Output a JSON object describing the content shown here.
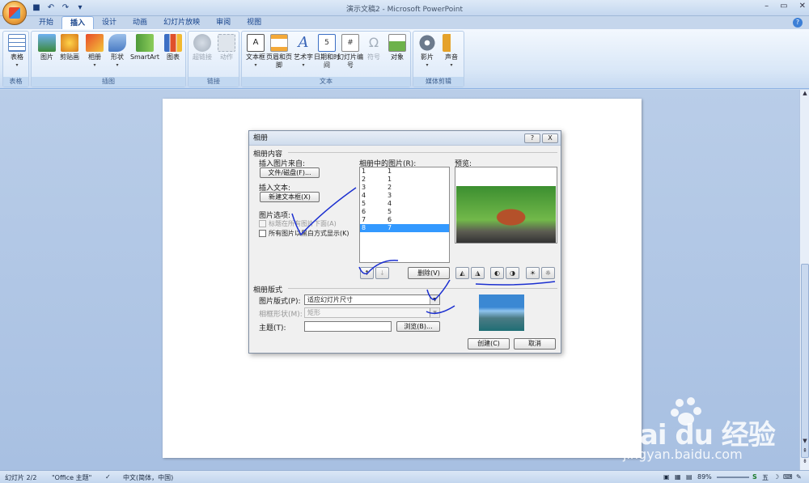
{
  "window": {
    "title": "演示文稿2 - Microsoft PowerPoint"
  },
  "ribbon_tabs": [
    "开始",
    "插入",
    "设计",
    "动画",
    "幻灯片放映",
    "审阅",
    "视图"
  ],
  "active_tab": "插入",
  "ribbon_groups": [
    {
      "label": "表格",
      "buttons": [
        {
          "label": "表格",
          "icon": "table-icon"
        }
      ]
    },
    {
      "label": "插图",
      "buttons": [
        {
          "label": "图片",
          "icon": "picture-icon"
        },
        {
          "label": "剪贴画",
          "icon": "clipart-icon"
        },
        {
          "label": "相册",
          "icon": "photo-album-icon"
        },
        {
          "label": "形状",
          "icon": "shapes-icon"
        },
        {
          "label": "SmartArt",
          "icon": "smartart-icon"
        },
        {
          "label": "图表",
          "icon": "chart-icon"
        }
      ]
    },
    {
      "label": "链接",
      "buttons": [
        {
          "label": "超链接",
          "icon": "hyperlink-icon"
        },
        {
          "label": "动作",
          "icon": "action-icon"
        }
      ]
    },
    {
      "label": "文本",
      "buttons": [
        {
          "label": "文本框",
          "icon": "textbox-icon"
        },
        {
          "label": "页眉和页脚",
          "icon": "header-footer-icon"
        },
        {
          "label": "艺术字",
          "icon": "wordart-icon"
        },
        {
          "label": "日期和时间",
          "icon": "date-time-icon"
        },
        {
          "label": "幻灯片编号",
          "icon": "slide-number-icon"
        },
        {
          "label": "符号",
          "icon": "symbol-icon"
        },
        {
          "label": "对象",
          "icon": "object-icon"
        }
      ]
    },
    {
      "label": "媒体剪辑",
      "buttons": [
        {
          "label": "影片",
          "icon": "movie-icon"
        },
        {
          "label": "声音",
          "icon": "sound-icon"
        }
      ]
    }
  ],
  "dialog": {
    "title": "相册",
    "album_content_label": "相册内容",
    "insert_from_label": "插入图片来自:",
    "file_disk_button": "文件/磁盘(F)...",
    "insert_text_label": "插入文本:",
    "new_textbox_button": "新建文本框(X)",
    "picture_options_label": "图片选项:",
    "caption_option": "标题在所有图片下面(A)",
    "bw_option": "所有图片以黑白方式显示(K)",
    "pictures_in_album_label": "相册中的图片(R):",
    "pictures": [
      {
        "num": "1",
        "name": "1"
      },
      {
        "num": "2",
        "name": "1"
      },
      {
        "num": "3",
        "name": "2"
      },
      {
        "num": "4",
        "name": "3"
      },
      {
        "num": "5",
        "name": "4"
      },
      {
        "num": "6",
        "name": "5"
      },
      {
        "num": "7",
        "name": "6"
      },
      {
        "num": "8",
        "name": "7"
      }
    ],
    "selected_index": 7,
    "preview_label": "预览:",
    "delete_button": "删除(V)",
    "album_layout_label": "相册版式",
    "picture_layout_label": "图片版式(P):",
    "picture_layout_value": "适应幻灯片尺寸",
    "frame_shape_label": "相框形状(M):",
    "frame_shape_value": "矩形",
    "theme_label": "主题(T):",
    "theme_value": "",
    "browse_button": "浏览(B)...",
    "create_button": "创建(C)",
    "cancel_button": "取消",
    "help_button": "?",
    "close_button": "X"
  },
  "status_bar": {
    "slide_info": "幻灯片 2/2",
    "theme": "\"Office 主题\"",
    "language": "中文(简体，中国)",
    "zoom": "89%"
  },
  "watermark": {
    "brand": "Bai du 经验",
    "url": "jingyan.baidu.com"
  }
}
